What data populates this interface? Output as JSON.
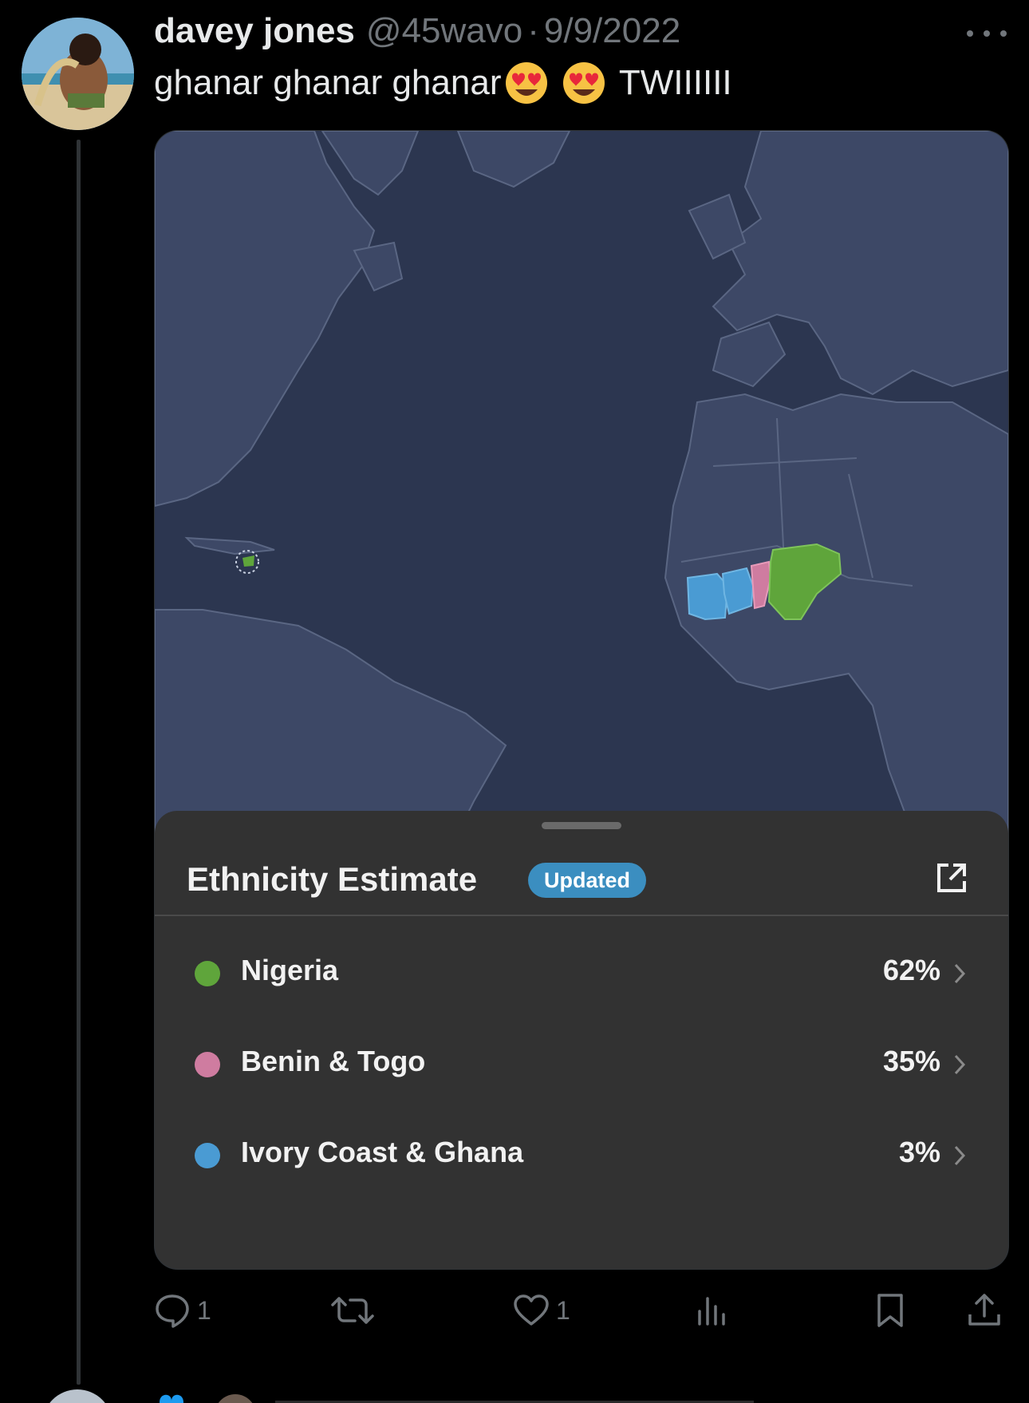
{
  "tweet": {
    "display_name": "davey jones",
    "handle": "@45wavo",
    "separator": "·",
    "date": "9/9/2022",
    "text_before": "ghanar ghanar ghanar",
    "text_after": " TWIIIIII",
    "emoji_1": "heart-eyes-emoji",
    "emoji_2": "heart-eyes-emoji"
  },
  "card": {
    "title": "Ethnicity Estimate",
    "badge": "Updated",
    "rows": [
      {
        "label": "Nigeria",
        "percent": "62%",
        "color": "#5fa53b"
      },
      {
        "label": "Benin & Togo",
        "percent": "35%",
        "color": "#cf7ca0"
      },
      {
        "label": "Ivory Coast & Ghana",
        "percent": "3%",
        "color": "#4a9bd3"
      }
    ]
  },
  "actions": {
    "reply_count": "1",
    "retweet_count": "",
    "like_count": "1"
  },
  "colors": {
    "background": "#000000",
    "secondary_text": "#71767b",
    "map_ocean": "#2c3650",
    "map_land": "#3d4866",
    "badge": "#3b8ec0"
  }
}
